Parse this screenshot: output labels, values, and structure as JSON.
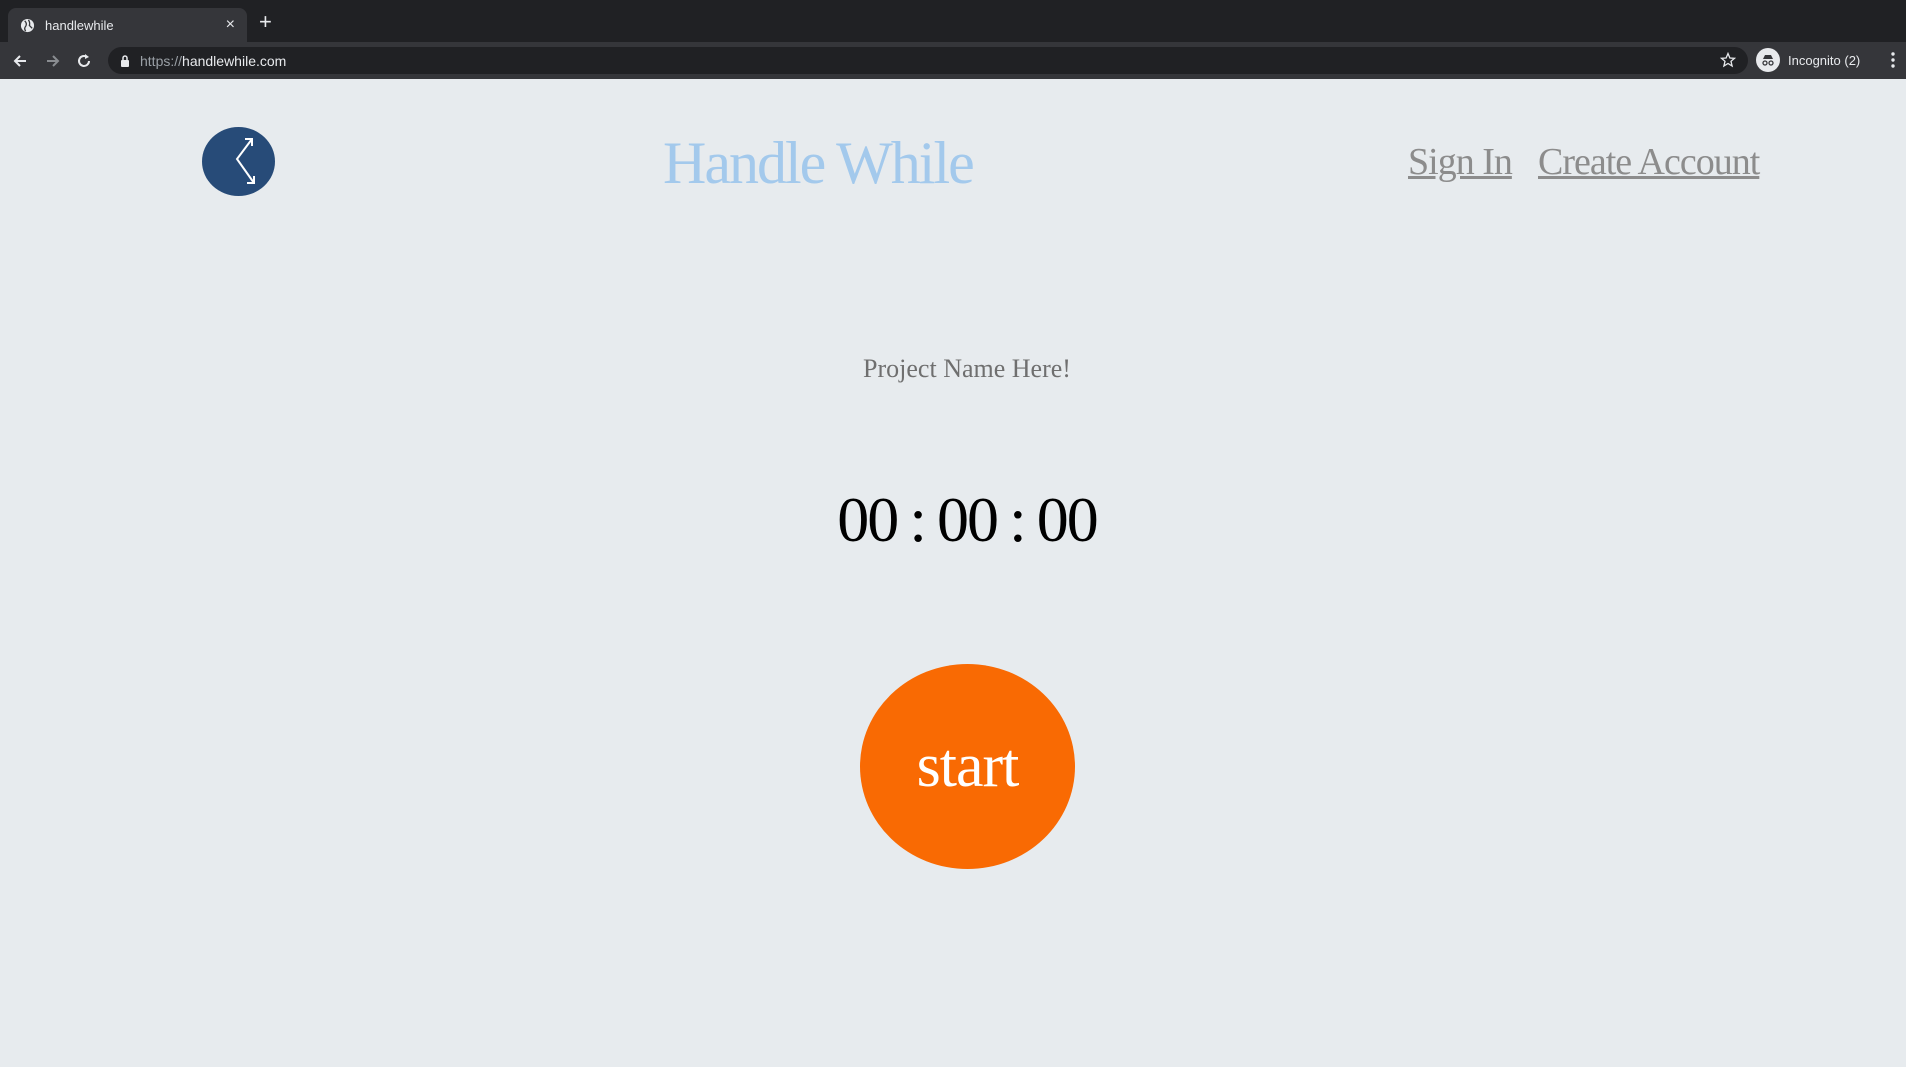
{
  "browser": {
    "tab_title": "handlewhile",
    "tab_close": "×",
    "new_tab": "+",
    "url_scheme": "https://",
    "url_host": "handlewhile.com",
    "incognito_label": "Incognito (2)"
  },
  "header": {
    "brand": "Handle While",
    "sign_in": "Sign In",
    "create_account": "Create Account"
  },
  "main": {
    "project_name": "Project Name Here!",
    "timer": {
      "hours": "00",
      "minutes": "00",
      "seconds": "00",
      "separator": ":"
    },
    "start_label": "start"
  },
  "colors": {
    "page_bg": "#e7ebee",
    "brand": "#a3c9ec",
    "logo_bg": "#274b78",
    "start_button": "#f96a03",
    "nav_link": "#8c8c8c"
  },
  "icons": [
    "globe-icon",
    "back-icon",
    "forward-icon",
    "reload-icon",
    "lock-icon",
    "star-icon",
    "incognito-icon",
    "menu-icon",
    "logo-arrows-icon"
  ]
}
